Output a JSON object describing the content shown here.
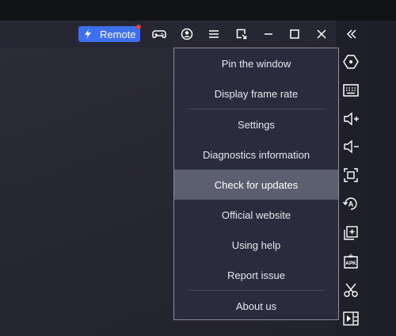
{
  "toolbar": {
    "remote_label": "Remote",
    "icons": [
      "gamepad-icon",
      "account-icon",
      "menu-icon",
      "resize-window-icon",
      "minimize-icon",
      "maximize-icon",
      "close-icon",
      "collapse-sidebar-icon"
    ]
  },
  "menu": {
    "items": [
      {
        "label": "Pin the window"
      },
      {
        "label": "Display frame rate"
      },
      {
        "label": "Settings"
      },
      {
        "label": "Diagnostics information"
      },
      {
        "label": "Check for updates",
        "highlighted": true
      },
      {
        "label": "Official website"
      },
      {
        "label": "Using help"
      },
      {
        "label": "Report issue"
      },
      {
        "label": "About us"
      }
    ]
  },
  "sidebar": {
    "icons": [
      "hexagon-icon",
      "keyboard-icon",
      "volume-up-icon",
      "volume-down-icon",
      "screenshot-icon",
      "auto-rotate-icon",
      "multi-instance-icon",
      "apk-install-icon",
      "scissors-icon",
      "media-icon"
    ]
  },
  "colors": {
    "accent": "#3d6ff0",
    "notification_dot": "#e04040",
    "menu_bg": "#2a2b3d",
    "menu_highlight": "#5c5f70"
  }
}
